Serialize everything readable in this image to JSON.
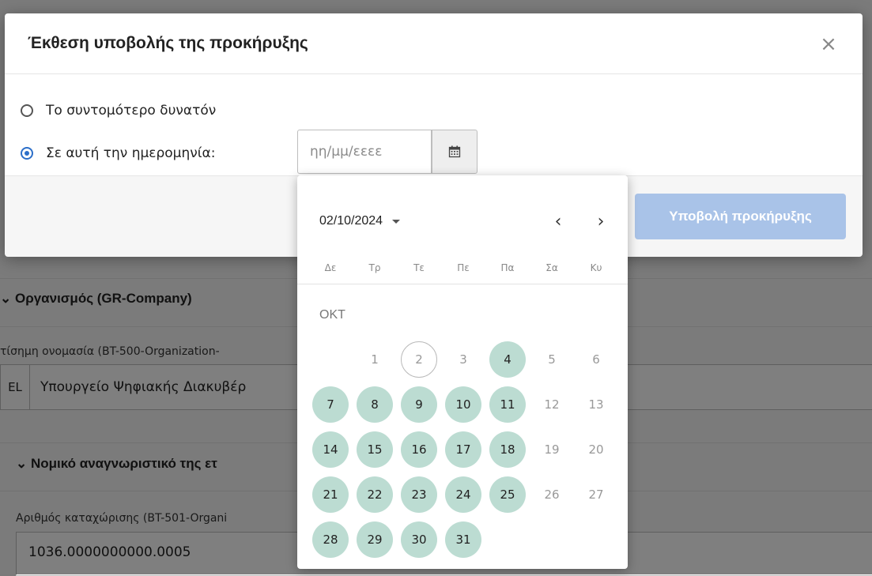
{
  "background": {
    "section_org_title": "⌄ Οργανισμός (GR-Company)",
    "official_name_label": "τίσημη ονομασία (BT-500-Organization-",
    "official_name_lang": "EL",
    "official_name_value": "Υπουργείο Ψηφιακής Διακυβέρ",
    "section_legal_title": "Νομικό αναγνωριστικό της ετ",
    "registration_label": "Αριθμός καταχώρισης (BT-501-Organi",
    "registration_value": "1036.0000000000.0005"
  },
  "modal": {
    "title": "Έκθεση υποβολής της προκήρυξης",
    "close_glyph": "×",
    "options": [
      {
        "label": "Το συντομότερο δυνατόν",
        "checked": false
      },
      {
        "label": "Σε αυτή την ημερομηνία:",
        "checked": true
      }
    ],
    "date_placeholder": "ηη/μμ/εεεε",
    "date_value": "",
    "calendar_icon": "calendar-icon",
    "submit_label": "Υποβολή προκήρυξης"
  },
  "datepicker": {
    "current_date": "02/10/2024",
    "prev_glyph": "‹",
    "next_glyph": "›",
    "weekdays": [
      "Δε",
      "Τρ",
      "Τε",
      "Πε",
      "Πα",
      "Σα",
      "Κυ"
    ],
    "month_label": "ΟΚΤ",
    "start_weekday_index": 1,
    "today": 2,
    "days": [
      1,
      2,
      3,
      4,
      5,
      6,
      7,
      8,
      9,
      10,
      11,
      12,
      13,
      14,
      15,
      16,
      17,
      18,
      19,
      20,
      21,
      22,
      23,
      24,
      25,
      26,
      27,
      28,
      29,
      30,
      31
    ],
    "available_days": [
      4,
      7,
      8,
      9,
      10,
      11,
      14,
      15,
      16,
      17,
      18,
      21,
      22,
      23,
      24,
      25,
      28,
      29,
      30,
      31
    ],
    "colors": {
      "available": "#bcdcd2",
      "primary": "#2c6fc9",
      "submit_disabled": "#a9c3e8"
    }
  }
}
